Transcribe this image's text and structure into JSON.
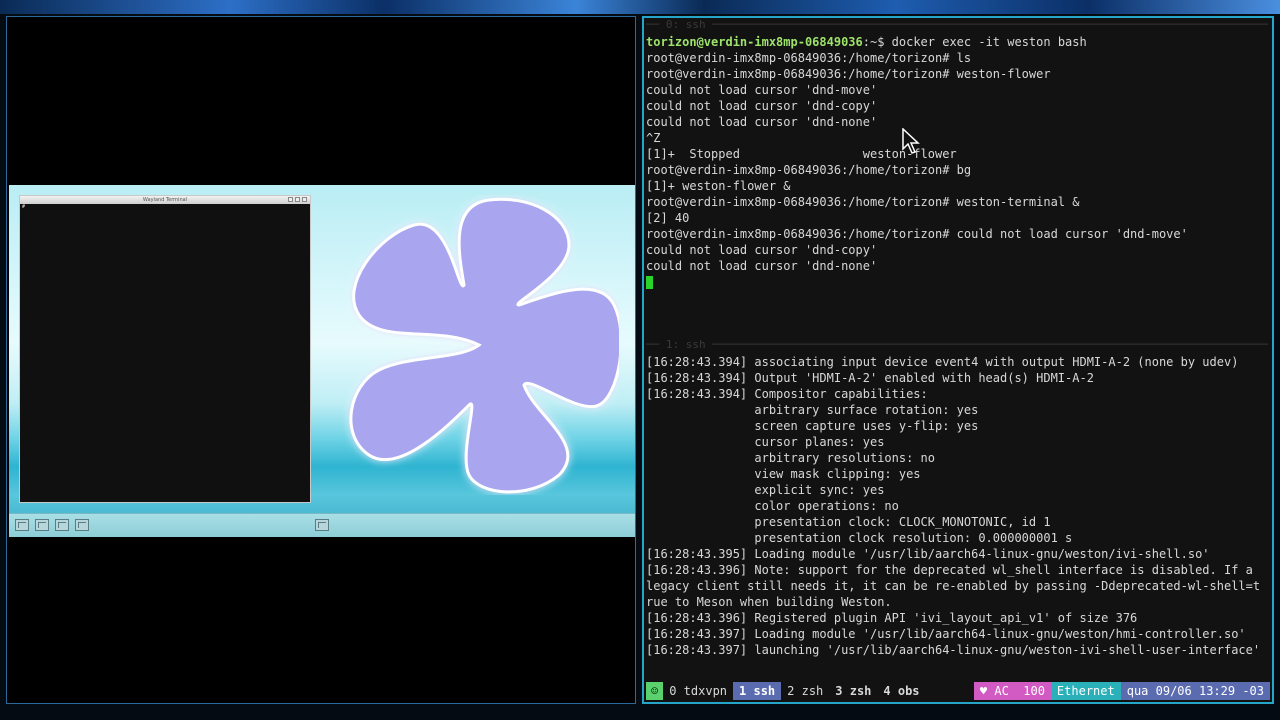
{
  "left": {
    "wl_terminal_title": "Wayland Terminal",
    "wl_prompt": "#"
  },
  "pane0": {
    "header": " 0: ssh ",
    "lines": [
      {
        "user": "torizon@verdin-imx8mp-06849036",
        "rest": ":~$ docker exec -it weston bash"
      },
      {
        "text": "root@verdin-imx8mp-06849036:/home/torizon# ls"
      },
      {
        "text": "root@verdin-imx8mp-06849036:/home/torizon# weston-flower"
      },
      {
        "text": "could not load cursor 'dnd-move'"
      },
      {
        "text": "could not load cursor 'dnd-copy'"
      },
      {
        "text": "could not load cursor 'dnd-none'"
      },
      {
        "text": "^Z"
      },
      {
        "text": "[1]+  Stopped                 weston-flower"
      },
      {
        "text": "root@verdin-imx8mp-06849036:/home/torizon# bg"
      },
      {
        "text": "[1]+ weston-flower &"
      },
      {
        "text": "root@verdin-imx8mp-06849036:/home/torizon# weston-terminal &"
      },
      {
        "text": "[2] 40"
      },
      {
        "text": "root@verdin-imx8mp-06849036:/home/torizon# could not load cursor 'dnd-move'"
      },
      {
        "text": "could not load cursor 'dnd-copy'"
      },
      {
        "text": "could not load cursor 'dnd-none'"
      }
    ]
  },
  "pane1": {
    "header": " 1: ssh ",
    "lines": [
      "[16:28:43.394] associating input device event4 with output HDMI-A-2 (none by udev)",
      "[16:28:43.394] Output 'HDMI-A-2' enabled with head(s) HDMI-A-2",
      "[16:28:43.394] Compositor capabilities:",
      "               arbitrary surface rotation: yes",
      "               screen capture uses y-flip: yes",
      "               cursor planes: yes",
      "               arbitrary resolutions: no",
      "               view mask clipping: yes",
      "               explicit sync: yes",
      "               color operations: no",
      "               presentation clock: CLOCK_MONOTONIC, id 1",
      "               presentation clock resolution: 0.000000001 s",
      "[16:28:43.395] Loading module '/usr/lib/aarch64-linux-gnu/weston/ivi-shell.so'",
      "[16:28:43.396] Note: support for the deprecated wl_shell interface is disabled. If a",
      "legacy client still needs it, it can be re-enabled by passing -Ddeprecated-wl-shell=t",
      "rue to Meson when building Weston.",
      "[16:28:43.396] Registered plugin API 'ivi_layout_api_v1' of size 376",
      "[16:28:43.397] Loading module '/usr/lib/aarch64-linux-gnu/weston/hmi-controller.so'",
      "[16:28:43.397] launching '/usr/lib/aarch64-linux-gnu/weston-ivi-shell-user-interface'"
    ]
  },
  "status": {
    "face": "☺",
    "win0": "0 tdxvpn",
    "win1": "1 ssh",
    "win2": "2 zsh",
    "win3": "3 zsh",
    "win4": "4 obs",
    "ac": "♥ AC  100",
    "net": "Ethernet",
    "date": "qua 09/06 13:29 -03"
  },
  "colors": {
    "pane_border": "#25a5c7",
    "prompt_user": "#9ee36a",
    "status_active": "#5b6bb0",
    "status_ac": "#d25bc3",
    "status_net": "#2ab0b8",
    "flower": "#a9a6ef"
  }
}
